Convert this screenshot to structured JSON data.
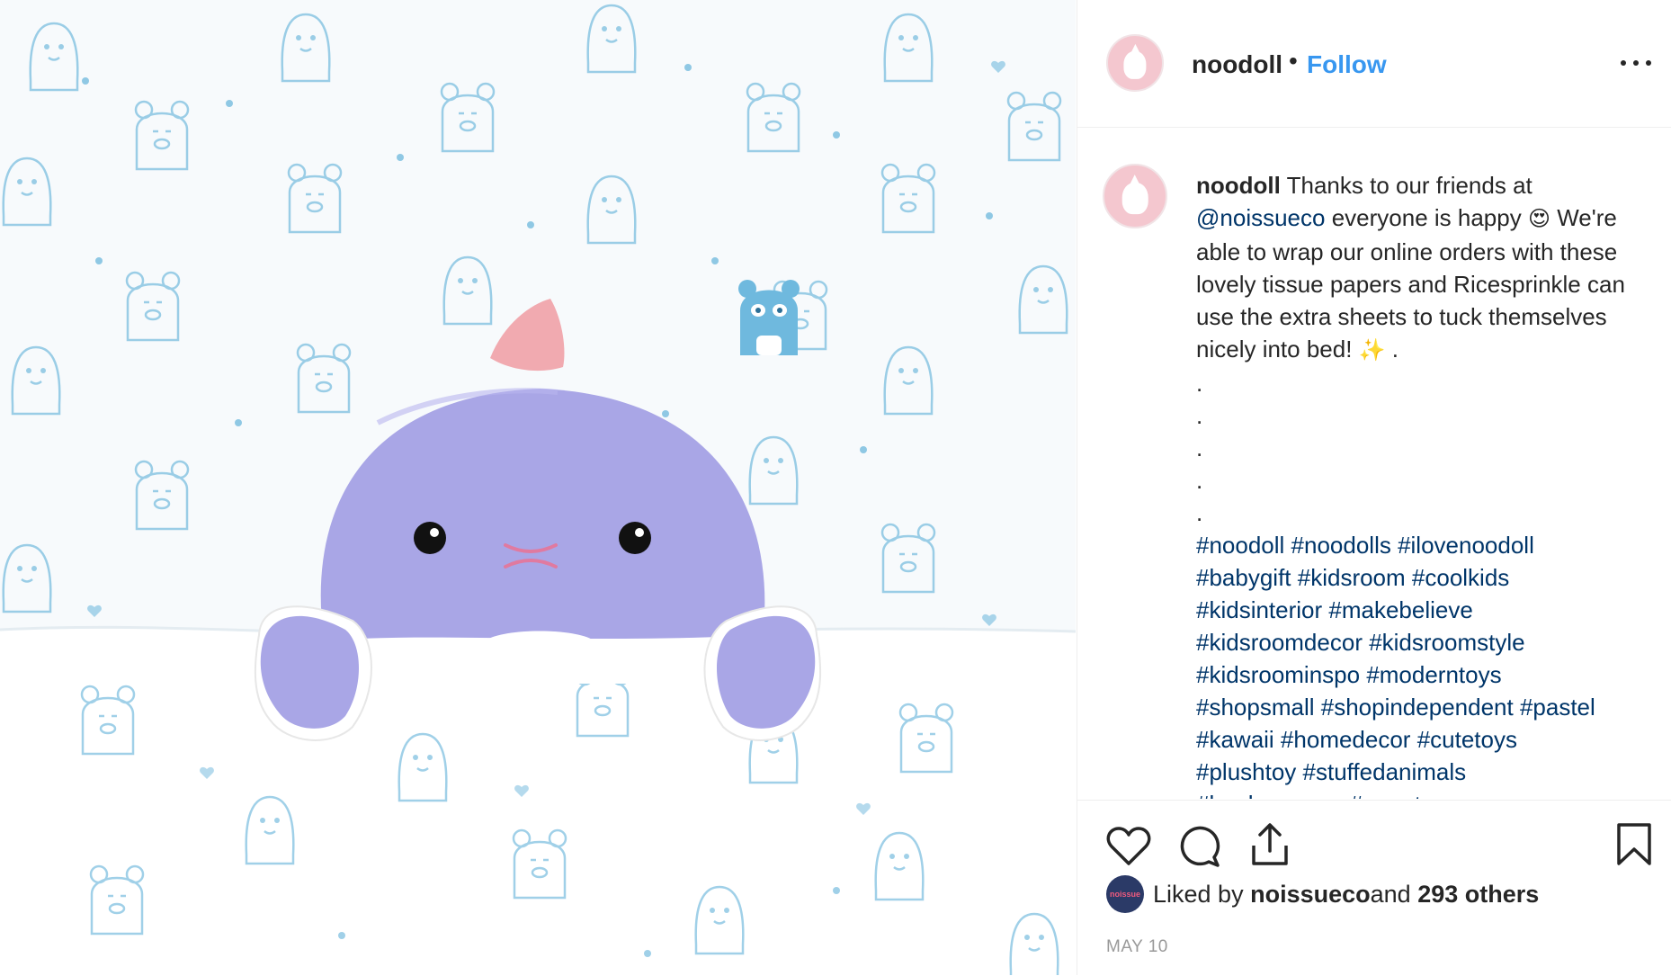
{
  "post": {
    "username": "noodoll",
    "dot": "•",
    "follow_label": "Follow",
    "more_icon": "more-options-icon"
  },
  "caption": {
    "username": "noodoll",
    "line1": " Thanks to our friends at",
    "mention": "@noissueco",
    "line2": " everyone is happy ",
    "emoji1": "😍",
    "line3": "We're able to wrap our online orders with these lovely tissue papers and Ricesprinkle can use the extra sheets to tuck themselves nicely into bed! ",
    "emoji2": "✨",
    "line3_end": " .",
    "dots": [
      ".",
      ".",
      ".",
      ".",
      "."
    ],
    "hashtags": [
      "#noodoll #noodolls #ilovenoodoll",
      "#babygift #kidsroom #coolkids",
      "#kidsinterior #makebelieve",
      "#kidsroomdecor #kidsroomstyle",
      "#kidsroominspo #moderntoys",
      "#shopsmall #shopindependent #pastel",
      "#kawaii #homedecor #cutetoys",
      "#plushtoy #stuffedanimals",
      "#londonmums #mumtrepreneur"
    ]
  },
  "actions": {
    "like_icon": "heart-icon",
    "comment_icon": "comment-icon",
    "share_icon": "share-icon",
    "save_icon": "bookmark-icon"
  },
  "likes": {
    "avatar_text": "noissue",
    "prefix": "Liked by ",
    "user": "noissueco",
    "middle": " and ",
    "count": "293 others"
  },
  "date": "MAY 10",
  "colors": {
    "follow": "#3897f0",
    "link": "#003569",
    "plush": "#a9a6e6",
    "pattern": "#7fc0e0"
  }
}
